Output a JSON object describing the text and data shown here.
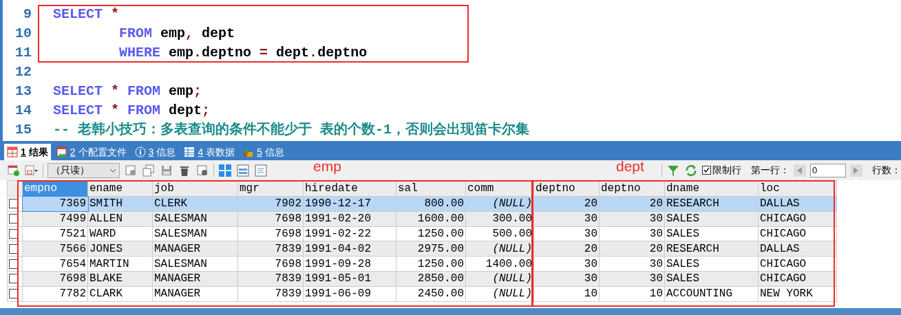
{
  "editor": {
    "lines": [
      {
        "number": "9",
        "highlighted": true,
        "tokens": [
          {
            "kind": "keyword",
            "text": "SELECT"
          },
          {
            "kind": "operator",
            "text": " *"
          }
        ]
      },
      {
        "number": "10",
        "highlighted": true,
        "tokens": [
          {
            "kind": "keyword",
            "text": "        FROM"
          },
          {
            "kind": "plain",
            "text": " emp"
          },
          {
            "kind": "operator",
            "text": ","
          },
          {
            "kind": "plain",
            "text": " dept"
          }
        ]
      },
      {
        "number": "11",
        "highlighted": true,
        "tokens": [
          {
            "kind": "keyword",
            "text": "        WHERE"
          },
          {
            "kind": "plain",
            "text": " emp"
          },
          {
            "kind": "operator",
            "text": "."
          },
          {
            "kind": "plain",
            "text": "deptno "
          },
          {
            "kind": "operator",
            "text": "="
          },
          {
            "kind": "plain",
            "text": " dept"
          },
          {
            "kind": "operator",
            "text": "."
          },
          {
            "kind": "plain",
            "text": "deptno"
          }
        ]
      },
      {
        "number": "12",
        "highlighted": false
      },
      {
        "number": "13",
        "highlighted": false,
        "tokens": [
          {
            "kind": "keyword",
            "text": "SELECT"
          },
          {
            "kind": "operator",
            "text": " *"
          },
          {
            "kind": "keyword",
            "text": " FROM"
          },
          {
            "kind": "plain",
            "text": " emp"
          },
          {
            "kind": "operator",
            "text": ";"
          }
        ]
      },
      {
        "number": "14",
        "highlighted": false,
        "tokens": [
          {
            "kind": "keyword",
            "text": "SELECT"
          },
          {
            "kind": "operator",
            "text": " *"
          },
          {
            "kind": "keyword",
            "text": " FROM"
          },
          {
            "kind": "plain",
            "text": " dept"
          },
          {
            "kind": "operator",
            "text": ";"
          }
        ]
      },
      {
        "number": "15",
        "highlighted": false,
        "tokens": [
          {
            "kind": "comment",
            "text": "-- 老韩小技巧：多表查询的条件不能少于 表的个数-1，否则会出现笛卡尔集"
          }
        ]
      }
    ]
  },
  "tabs": [
    {
      "number": "1",
      "label": "结果",
      "selected": true,
      "kind": "grid"
    },
    {
      "number": "2",
      "label": "个配置文件",
      "selected": false,
      "kind": "profile"
    },
    {
      "number": "3",
      "label": "信息",
      "selected": false,
      "kind": "info"
    },
    {
      "number": "4",
      "label": "表数据",
      "selected": false,
      "kind": "table"
    },
    {
      "number": "5",
      "label": "信息",
      "selected": false,
      "kind": "shapes"
    }
  ],
  "toolbar": {
    "mode_select": "（只读）",
    "limit_rows": {
      "label": "限制行",
      "checked": true
    },
    "first_row_label": "第一行：",
    "first_row_value": "0",
    "row_count_label": "行数："
  },
  "table": {
    "groups": [
      {
        "label": "emp",
        "columns": [
          {
            "name": "empno",
            "kind": "number"
          },
          {
            "name": "ename",
            "kind": "text"
          },
          {
            "name": "job",
            "kind": "text"
          },
          {
            "name": "mgr",
            "kind": "number"
          },
          {
            "name": "hiredate",
            "kind": "text"
          },
          {
            "name": "sal",
            "kind": "number"
          },
          {
            "name": "comm",
            "kind": "number"
          }
        ]
      },
      {
        "label": "dept",
        "columns": [
          {
            "name": "deptno",
            "kind": "number"
          },
          {
            "name": "deptno",
            "kind": "number"
          },
          {
            "name": "dname",
            "kind": "text"
          },
          {
            "name": "loc",
            "kind": "text"
          }
        ]
      }
    ],
    "rows": [
      {
        "selected": true,
        "checked": false,
        "cells": [
          "7369",
          "SMITH",
          "CLERK",
          "7902",
          "1990-12-17",
          "800.00",
          {
            "kind": "null",
            "text": "(NULL)"
          },
          "20",
          "20",
          "RESEARCH",
          "DALLAS"
        ]
      },
      {
        "selected": false,
        "checked": false,
        "cells": [
          "7499",
          "ALLEN",
          "SALESMAN",
          "7698",
          "1991-02-20",
          "1600.00",
          "300.00",
          "30",
          "30",
          "SALES",
          "CHICAGO"
        ]
      },
      {
        "selected": false,
        "checked": false,
        "cells": [
          "7521",
          "WARD",
          "SALESMAN",
          "7698",
          "1991-02-22",
          "1250.00",
          "500.00",
          "30",
          "30",
          "SALES",
          "CHICAGO"
        ]
      },
      {
        "selected": false,
        "checked": false,
        "cells": [
          "7566",
          "JONES",
          "MANAGER",
          "7839",
          "1991-04-02",
          "2975.00",
          {
            "kind": "null",
            "text": "(NULL)"
          },
          "20",
          "20",
          "RESEARCH",
          "DALLAS"
        ]
      },
      {
        "selected": false,
        "checked": false,
        "cells": [
          "7654",
          "MARTIN",
          "SALESMAN",
          "7698",
          "1991-09-28",
          "1250.00",
          "1400.00",
          "30",
          "30",
          "SALES",
          "CHICAGO"
        ]
      },
      {
        "selected": false,
        "checked": false,
        "cells": [
          "7698",
          "BLAKE",
          "MANAGER",
          "7839",
          "1991-05-01",
          "2850.00",
          {
            "kind": "null",
            "text": "(NULL)"
          },
          "30",
          "30",
          "SALES",
          "CHICAGO"
        ]
      },
      {
        "selected": false,
        "checked": false,
        "cells": [
          "7782",
          "CLARK",
          "MANAGER",
          "7839",
          "1991-06-09",
          "2450.00",
          {
            "kind": "null",
            "text": "(NULL)"
          },
          "10",
          "10",
          "ACCOUNTING",
          "NEW YORK"
        ]
      }
    ]
  }
}
